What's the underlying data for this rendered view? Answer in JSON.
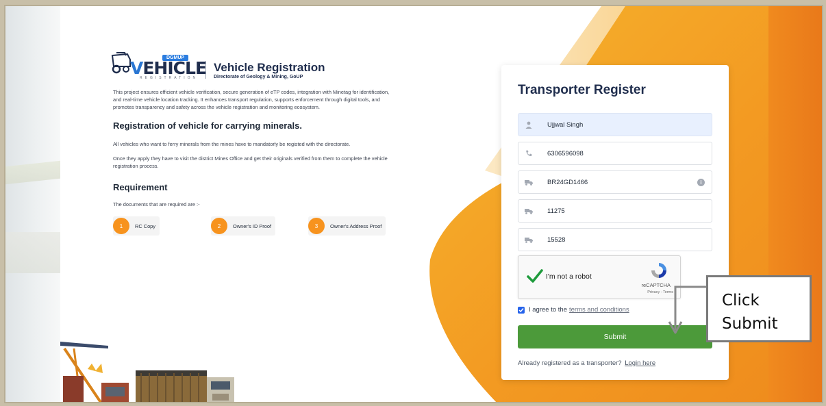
{
  "brand": {
    "badge": "DGMUP",
    "logo_text": "VEHICLE",
    "logo_sub": "REGISTRATION",
    "title": "Vehicle Registration",
    "subtitle": "Directorate of Geology & Mining, GoUP"
  },
  "intro": "This project ensures efficient vehicle verification, secure generation of eTP codes, integration with Minetag for identification, and real-time vehicle location tracking. It enhances transport regulation, supports enforcement through digital tools, and promotes transparency and safety across the vehicle registration and monitoring ecosystem.",
  "section1": {
    "heading": "Registration of vehicle for carrying minerals.",
    "para1": "All vehicles who want to ferry minerals from the mines have to mandatorly be registed with the directorate.",
    "para2": "Once they apply they have to visit the district Mines Office and get their originals verified from them to complete the vehicle registration process."
  },
  "requirement": {
    "heading": "Requirement",
    "lead": "The documents that are required are :-",
    "items": [
      {
        "num": "1",
        "label": "RC Copy"
      },
      {
        "num": "2",
        "label": "Owner's ID Proof"
      },
      {
        "num": "3",
        "label": "Owner's Address Proof"
      }
    ]
  },
  "form": {
    "title": "Transporter Register",
    "fields": [
      {
        "icon": "user-icon",
        "value": "Ujjwal Singh"
      },
      {
        "icon": "phone-icon",
        "value": "6306596098"
      },
      {
        "icon": "truck-icon",
        "value": "BR24GD1466"
      },
      {
        "icon": "truck-icon",
        "value": "11275"
      },
      {
        "icon": "truck-icon",
        "value": "15528"
      }
    ],
    "captcha": {
      "label": "I'm not a robot",
      "brand": "reCAPTCHA",
      "links": "Privacy - Terms"
    },
    "agree_text": "I agree to the",
    "agree_link": "terms and conditions",
    "submit": "Submit",
    "already_text": "Already registered as a transporter?",
    "login_link": "Login here"
  },
  "callout": {
    "line1": "Click",
    "line2": "Submit"
  },
  "colors": {
    "accent_orange": "#f7931e",
    "submit_green": "#4c9a3a",
    "navy": "#1f2d4d"
  }
}
